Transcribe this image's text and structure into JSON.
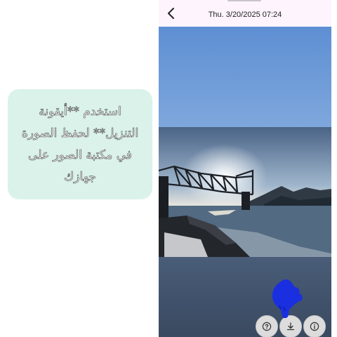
{
  "callout": {
    "lines": [
      "استخدم **أيقونة",
      "التنزيل** لحفظ الصورة",
      "في مكتبة الصور على",
      "جهازك"
    ]
  },
  "viewer": {
    "datetime": "Thu. 3/20/2025  07:24"
  },
  "toolbar": {
    "buttons": [
      "help-icon",
      "download-icon",
      "info-icon"
    ]
  },
  "colors": {
    "callout_bg": "#daf2ea",
    "pointer_hand": "#1a2fe0",
    "header_bg": "#fdf4fd"
  }
}
